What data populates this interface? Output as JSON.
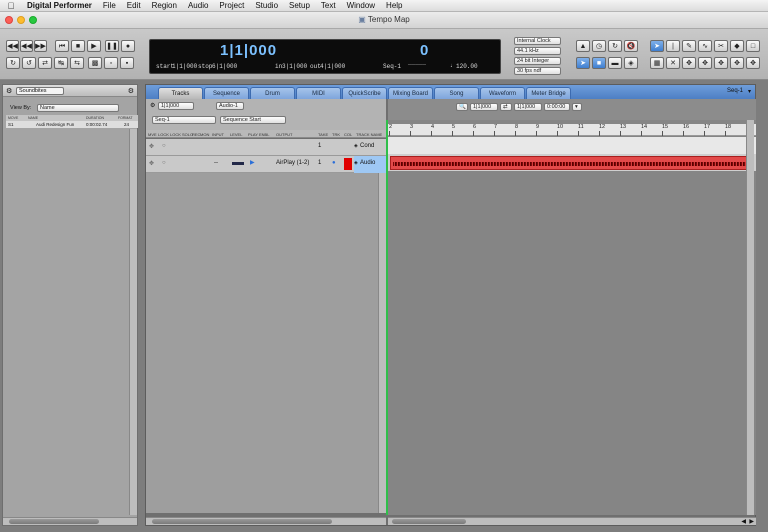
{
  "menubar": {
    "apple": "",
    "items": [
      "Digital Performer",
      "File",
      "Edit",
      "Region",
      "Audio",
      "Project",
      "Studio",
      "Setup",
      "Text",
      "Window",
      "Help"
    ]
  },
  "window": {
    "title": "Tempo Map"
  },
  "counter": {
    "main": "1|1|000",
    "secondary": "0",
    "start_label": "start",
    "start_value": "1|1|000",
    "stop_label": "stop",
    "stop_value": "6|1|000",
    "in_label": "in",
    "in_value": "3|1|000",
    "out_label": "out",
    "out_value": "4|1|000",
    "seq": "Seq-1",
    "tempo": "120.00"
  },
  "clock_settings": [
    "Internal Clock",
    "44.1 kHz",
    "24 bit Integer",
    "30 fps ndf"
  ],
  "left_panel": {
    "title": "Soundbites",
    "view_by_label": "View By:",
    "view_by_value": "Name",
    "columns": [
      "MOVE",
      "NAME",
      "DURATION",
      "FORMAT"
    ],
    "rows": [
      {
        "move": "S1",
        "name": "Audi Redesign Fun",
        "duration": "0:00:02.74",
        "format": "24"
      }
    ]
  },
  "tabs": [
    "Tracks",
    "Sequence",
    "Drum",
    "MIDI",
    "QuickScribe",
    "Mixing Board",
    "Song",
    "Waveform",
    "Meter Bridge"
  ],
  "seq_menu": "Seq-1",
  "track_controls": {
    "counter_left": "1|1|000",
    "counter_right": "Audio-1",
    "seq_select": "Seq-1",
    "start_select": "Sequence Start"
  },
  "track_headers": [
    "MVE",
    "LOCK",
    "LOCK",
    "SOLO",
    "REC",
    "MON",
    "INPUT",
    "LEVEL",
    "PLAY ENBL",
    "OUTPUT",
    "TAKE",
    "TRK",
    "COL",
    "TRACK NAME"
  ],
  "tracks": [
    {
      "name": "Cond",
      "take": "1",
      "input": "",
      "output": ""
    },
    {
      "name": "Audio",
      "take": "1",
      "input": "--",
      "output": "AirPlay (1-2)"
    }
  ],
  "timeline_counter": [
    "1|1|000",
    "1|1|000",
    "0:00:00"
  ],
  "ruler": [
    "2",
    "3",
    "4",
    "5",
    "6",
    "7",
    "8",
    "9",
    "10",
    "11",
    "12",
    "13",
    "14",
    "15",
    "16",
    "17",
    "18"
  ],
  "colors": {
    "accent": "#7cc1ff",
    "tab_blue": "#5b8ad0",
    "region": "#e34a4a",
    "playhead": "#2fbf4a"
  }
}
